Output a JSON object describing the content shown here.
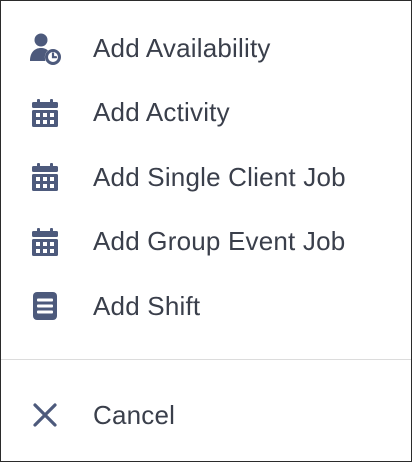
{
  "menu": {
    "icon_color": "#4d5a7c",
    "text_color": "#3a3f4b",
    "items": [
      {
        "label": "Add Availability",
        "icon": "person-clock-icon"
      },
      {
        "label": "Add Activity",
        "icon": "calendar-icon"
      },
      {
        "label": "Add Single Client Job",
        "icon": "calendar-icon"
      },
      {
        "label": "Add Group Event Job",
        "icon": "calendar-icon"
      },
      {
        "label": "Add Shift",
        "icon": "list-icon"
      }
    ],
    "cancel": {
      "label": "Cancel",
      "icon": "close-icon"
    }
  }
}
